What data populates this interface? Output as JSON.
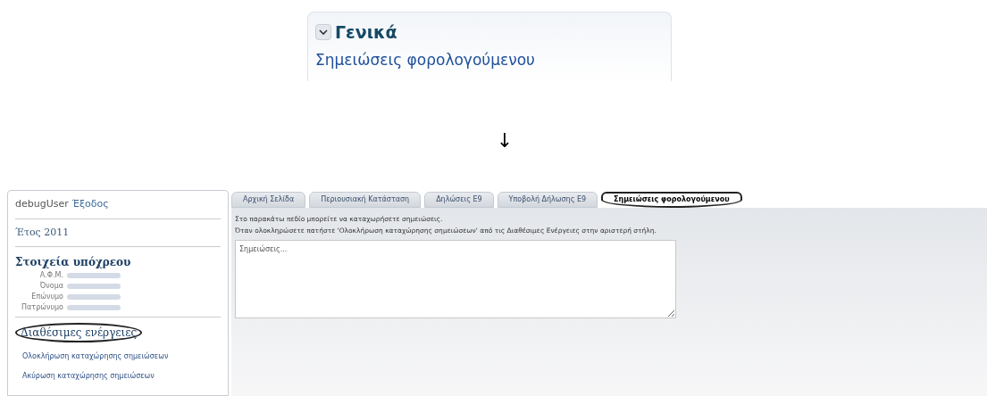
{
  "menu_panel": {
    "title": "Γενικά",
    "expanded": true,
    "link": "Σημειώσεις φορολογούμενου"
  },
  "arrow": "↓",
  "sidebar": {
    "user": "debugUser",
    "logout": "Έξοδος",
    "year": "Έτος 2011",
    "taxpayer_heading": "Στοιχεία υπόχρεου",
    "fields": [
      {
        "label": "Α.Φ.Μ."
      },
      {
        "label": "Όνομα"
      },
      {
        "label": "Επώνυμο"
      },
      {
        "label": "Πατρώνυμο"
      }
    ],
    "actions_heading": "Διαθέσιμες ενέργειες",
    "actions_circled": true,
    "actions": [
      "Ολοκλήρωση καταχώρησης σημειώσεων",
      "Ακύρωση καταχώρησης σημειώσεων"
    ]
  },
  "tabs": [
    {
      "label": "Αρχική Σελίδα",
      "selected": false
    },
    {
      "label": "Περιουσιακή Κατάσταση",
      "selected": false
    },
    {
      "label": "Δηλώσεις Ε9",
      "selected": false
    },
    {
      "label": "Υποβολή Δήλωσης Ε9",
      "selected": false
    },
    {
      "label": "Σημειώσεις φορολογούμενου",
      "selected": true
    }
  ],
  "instructions": [
    "Στο παρακάτω πεδίο μπορείτε να καταχωρήσετε σημειώσεις.",
    "Όταν ολοκληρώσετε πατήστε 'Ολοκλήρωση καταχώρησης σημειώσεων' από τις Διαθέσιμες Ενέργειες στην αριστερή στήλη."
  ],
  "notes": {
    "placeholder": "Σημειώσεις..."
  }
}
